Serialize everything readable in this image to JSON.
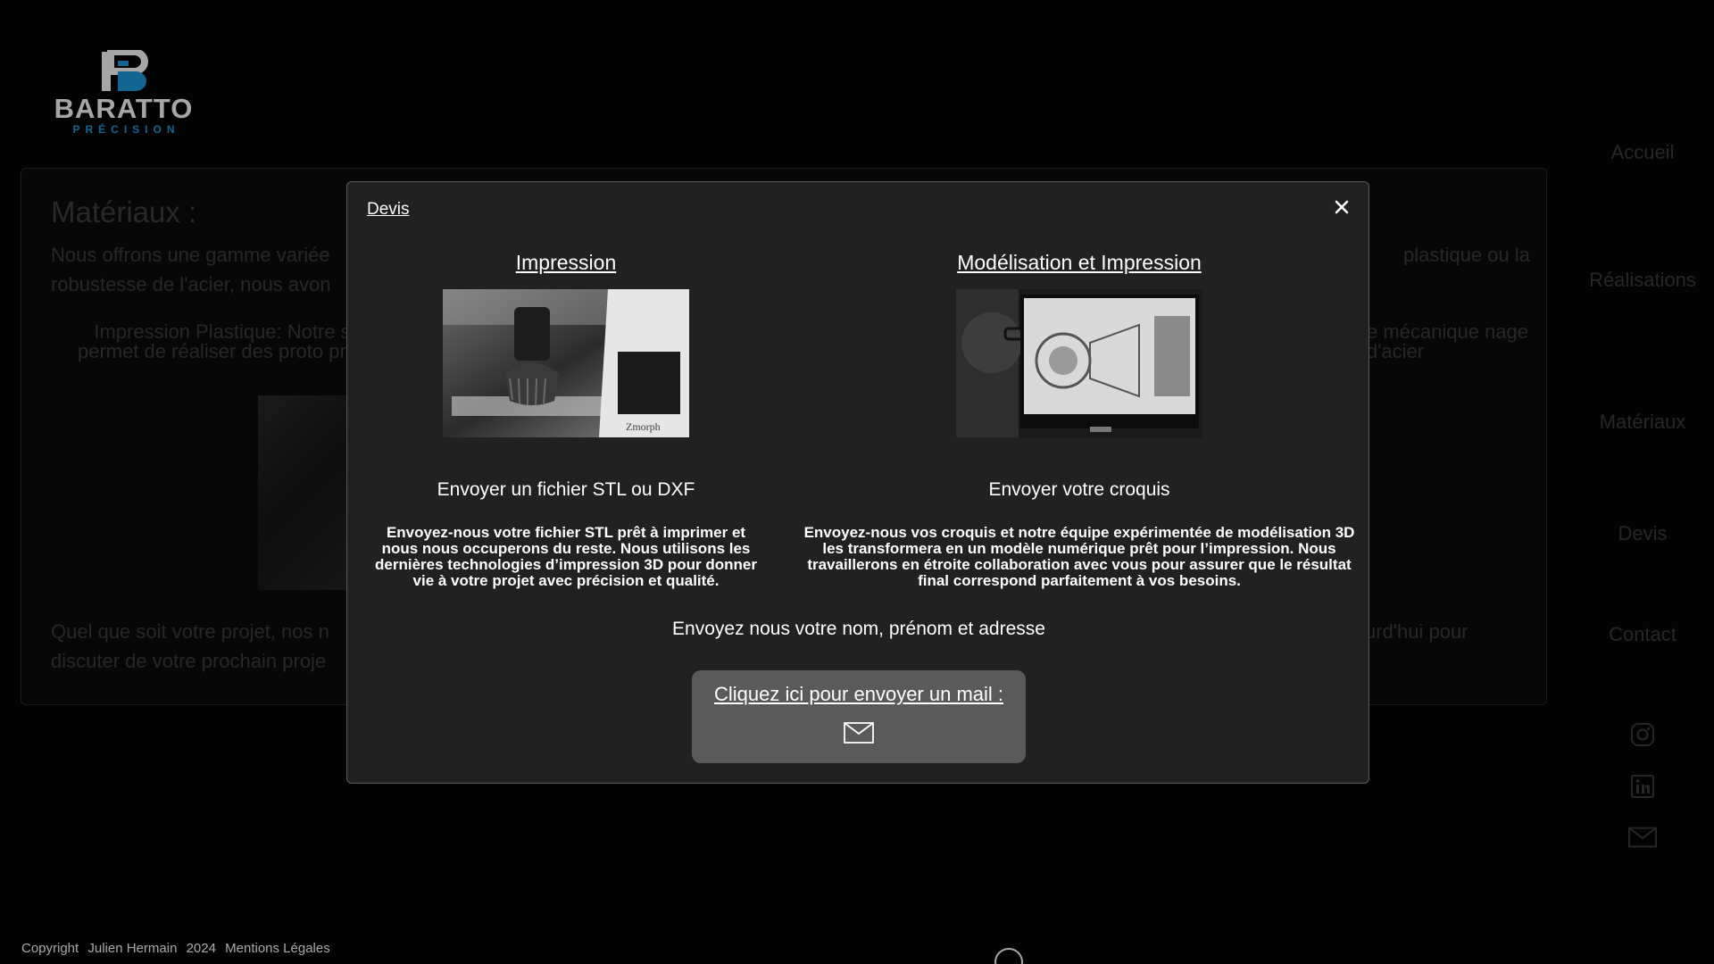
{
  "brand": {
    "name": "BARATTO",
    "subtitle": "PRÉCISION",
    "accent": "#1e9be0"
  },
  "nav": {
    "items": [
      {
        "label": "Accueil"
      },
      {
        "label": "Réalisations"
      },
      {
        "label": "Matériaux"
      },
      {
        "label": "Devis"
      },
      {
        "label": "Contact"
      }
    ],
    "social": [
      "instagram-icon",
      "linkedin-icon",
      "mail-icon"
    ]
  },
  "background": {
    "title": "Matériaux :",
    "intro_left": "Nous offrons une gamme variée robustesse de l'acier, nous avon",
    "intro_right": "plastique ou la",
    "plastic_left": "Impression Plastique: Notre s permet de réaliser des proto préc",
    "steel_right": "e mécanique nage d'acier",
    "outro_left": "Quel que soit votre projet, nos n discuter de votre prochain proje",
    "outro_right": "urd'hui pour"
  },
  "modal": {
    "title": "Devis",
    "close_label": "×",
    "left": {
      "heading": "Impression",
      "subheading": "Envoyer un fichier STL ou DXF",
      "description": "Envoyez-nous votre fichier STL prêt à imprimer et nous nous occuperons du reste. Nous utilisons les dernières technologies d’impression 3D pour donner vie à votre projet avec précision et qualité."
    },
    "right": {
      "heading": "Modélisation et Impression",
      "subheading": "Envoyer votre croquis",
      "description": "Envoyez-nous vos croquis et notre équipe expérimentée de modélisation 3D les transformera en un modèle numérique prêt pour l’impression. Nous travaillerons en étroite collaboration avec vous pour assurer que le résultat final correspond parfaitement à vos besoins."
    },
    "center_text": "Envoyez nous votre nom, prénom et adresse",
    "mail_button_label": "Cliquez ici pour envoyer un mail :"
  },
  "footer": {
    "copyright": "Copyright",
    "author": "Julien Hermain",
    "year": "2024",
    "legal": "Mentions Légales"
  }
}
